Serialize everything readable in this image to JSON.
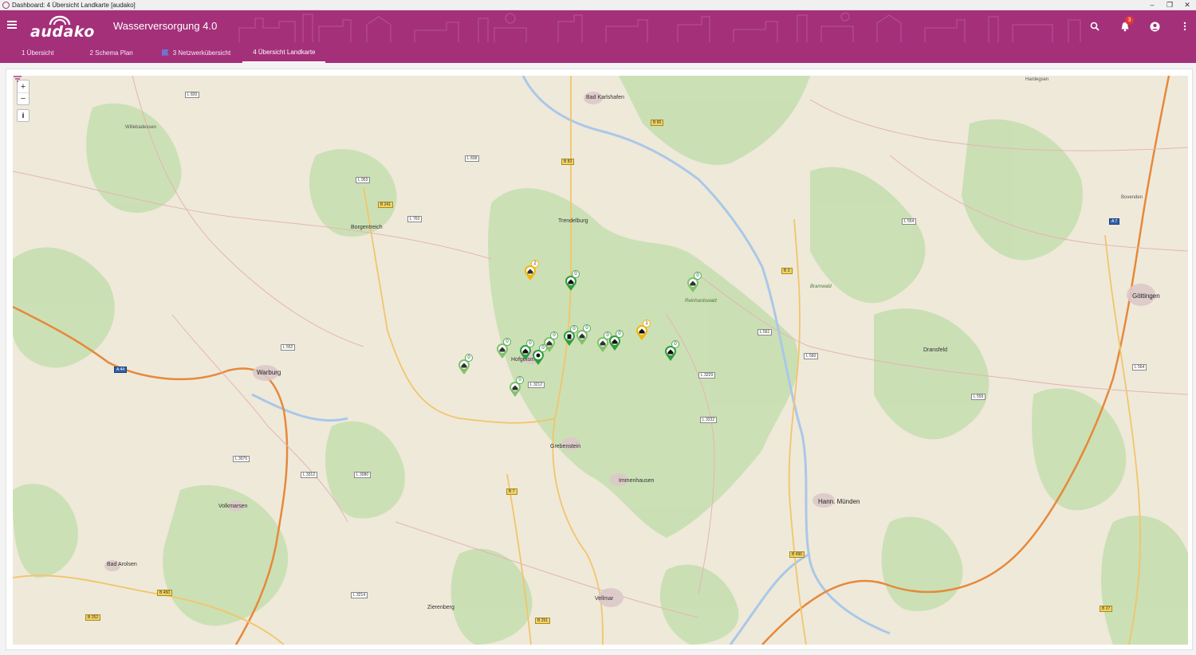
{
  "window": {
    "title": "Dashboard: 4 Übersicht Landkarte [audako]",
    "minimize": "–",
    "restore": "❐",
    "close": "✕"
  },
  "header": {
    "logo": "audako",
    "app_title": "Wasserversorgung 4.0",
    "notification_count": "3",
    "icons": [
      "menu-icon",
      "search-icon",
      "bell-icon",
      "account-icon",
      "more-vert-icon"
    ],
    "colors": {
      "brand": "#a4307a",
      "badge": "#e53935"
    }
  },
  "tabs": [
    {
      "label": "1 Übersicht",
      "icon": ""
    },
    {
      "label": "2 Schema Plan",
      "icon": ""
    },
    {
      "label": "3 Netzwerkübersicht",
      "icon": "flag-icon"
    },
    {
      "label": "4 Übersicht Landkarte",
      "icon": ""
    }
  ],
  "active_tab": "4 Übersicht Landkarte",
  "map": {
    "zoom_in": "+",
    "zoom_out": "−",
    "info": "i",
    "cities": [
      "Bad Karlshafen",
      "Trendelburg",
      "Hofgeismar",
      "Grebenstein",
      "Immenhausen",
      "Hann. Münden",
      "Göttingen",
      "Warburg",
      "Volkmarsen",
      "Borgentreich",
      "Bad Arolsen",
      "Zierenberg",
      "Vellmar",
      "Dransfeld",
      "Willebadessen",
      "Hardegsen",
      "Bovenden",
      "Reinhardswald",
      "Bramwald"
    ],
    "roads": [
      "B 83",
      "B 80",
      "B 3",
      "B 7",
      "A 44",
      "A 7",
      "B 241",
      "B 252",
      "B 450",
      "B 251",
      "B 496",
      "B 27",
      "L 763",
      "L 552",
      "L 3212",
      "L 3232",
      "L 3229",
      "L 3214",
      "L 3075",
      "L 3312",
      "L 3080",
      "L 561",
      "L 560",
      "L 554",
      "L 559",
      "L 564",
      "L 838",
      "L 953",
      "L 820"
    ],
    "markers": [
      {
        "count": "2",
        "status": "warning"
      },
      {
        "count": "0",
        "status": "ok"
      },
      {
        "count": "0",
        "status": "ok"
      },
      {
        "count": "0",
        "status": "ok"
      },
      {
        "count": "0",
        "status": "ok"
      },
      {
        "count": "0",
        "status": "ok"
      },
      {
        "count": "0",
        "status": "ok"
      },
      {
        "count": "0",
        "status": "ok"
      },
      {
        "count": "0",
        "status": "ok"
      },
      {
        "count": "0",
        "status": "ok"
      },
      {
        "count": "0",
        "status": "ok"
      },
      {
        "count": "0",
        "status": "ok"
      },
      {
        "count": "1",
        "status": "warning"
      },
      {
        "count": "0",
        "status": "ok"
      },
      {
        "count": "0",
        "status": "ok"
      }
    ]
  }
}
